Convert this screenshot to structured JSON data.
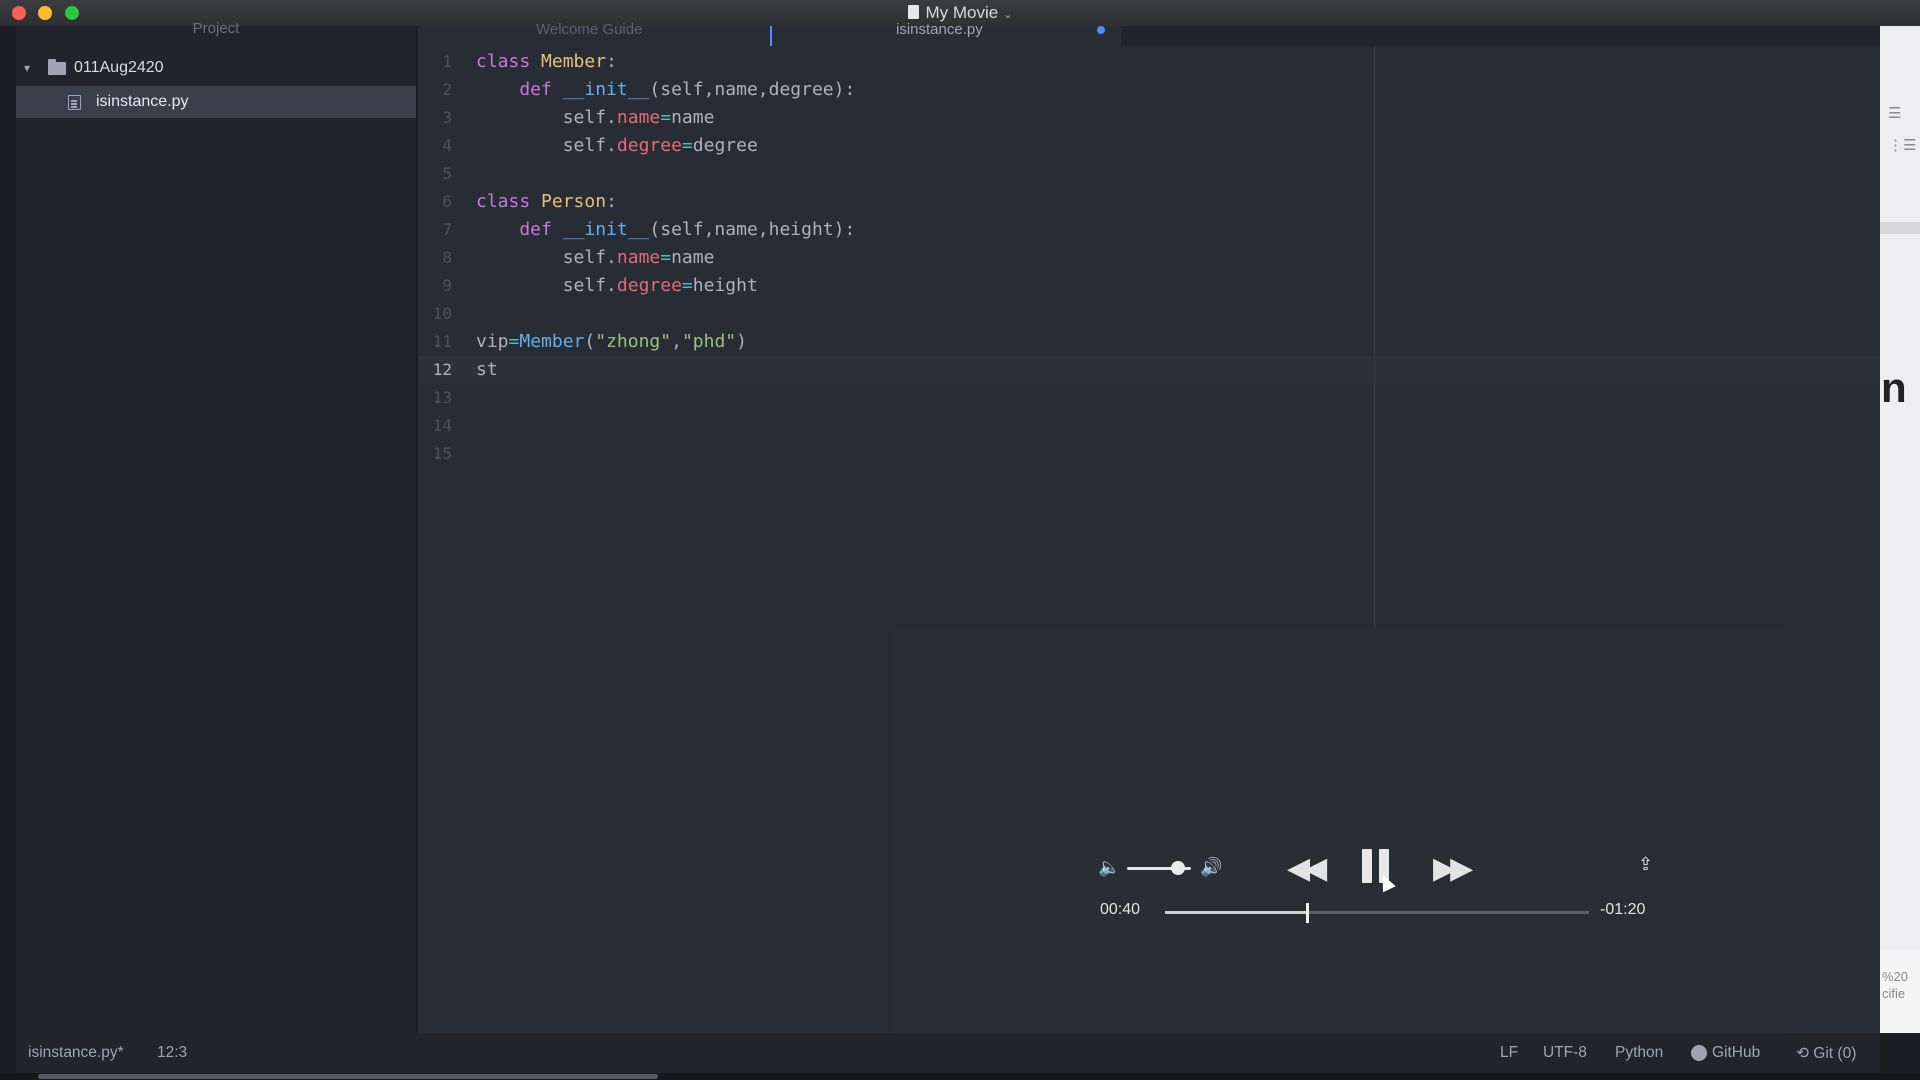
{
  "window": {
    "title": "My Movie",
    "title_chevron": "⌄"
  },
  "sidebar": {
    "panel_title": "Project",
    "root_folder": "011Aug2420",
    "root_arrow": "▾",
    "files": [
      {
        "label": "isinstance.py",
        "selected": true
      }
    ]
  },
  "tabs": [
    {
      "label": "Welcome Guide",
      "active": false
    },
    {
      "label": "isinstance.py",
      "active": true,
      "modified": true
    }
  ],
  "editor": {
    "current_line": 12,
    "line_numbers": [
      "1",
      "2",
      "3",
      "4",
      "5",
      "6",
      "7",
      "8",
      "9",
      "10",
      "11",
      "12",
      "13",
      "14",
      "15"
    ],
    "lines": [
      [
        {
          "t": "class ",
          "c": "kw"
        },
        {
          "t": "Member",
          "c": "cls"
        },
        {
          "t": ":",
          "c": "plain"
        }
      ],
      [
        {
          "t": "    def ",
          "c": "kw"
        },
        {
          "t": "__init__",
          "c": "fn"
        },
        {
          "t": "(self,name,degree):",
          "c": "plain"
        }
      ],
      [
        {
          "t": "        self.",
          "c": "plain"
        },
        {
          "t": "name",
          "c": "prop"
        },
        {
          "t": "=",
          "c": "op"
        },
        {
          "t": "name",
          "c": "plain"
        }
      ],
      [
        {
          "t": "        self.",
          "c": "plain"
        },
        {
          "t": "degree",
          "c": "prop"
        },
        {
          "t": "=",
          "c": "op"
        },
        {
          "t": "degree",
          "c": "plain"
        }
      ],
      [],
      [
        {
          "t": "class ",
          "c": "kw"
        },
        {
          "t": "Person",
          "c": "cls"
        },
        {
          "t": ":",
          "c": "plain"
        }
      ],
      [
        {
          "t": "    def ",
          "c": "kw"
        },
        {
          "t": "__init__",
          "c": "fn"
        },
        {
          "t": "(self,name,height):",
          "c": "plain"
        }
      ],
      [
        {
          "t": "        self.",
          "c": "plain"
        },
        {
          "t": "name",
          "c": "prop"
        },
        {
          "t": "=",
          "c": "op"
        },
        {
          "t": "name",
          "c": "plain"
        }
      ],
      [
        {
          "t": "        self.",
          "c": "plain"
        },
        {
          "t": "degree",
          "c": "prop"
        },
        {
          "t": "=",
          "c": "op"
        },
        {
          "t": "height",
          "c": "plain"
        }
      ],
      [],
      [
        {
          "t": "vip",
          "c": "plain"
        },
        {
          "t": "=",
          "c": "op"
        },
        {
          "t": "Member",
          "c": "fn"
        },
        {
          "t": "(",
          "c": "plain"
        },
        {
          "t": "\"zhong\"",
          "c": "str"
        },
        {
          "t": ",",
          "c": "plain"
        },
        {
          "t": "\"phd\"",
          "c": "str"
        },
        {
          "t": ")",
          "c": "plain"
        }
      ],
      [
        {
          "t": "st",
          "c": "plain"
        }
      ],
      [],
      [],
      []
    ]
  },
  "player": {
    "current_time": "00:40",
    "remaining_time": "-01:20",
    "progress": 0.333,
    "volume": 0.8,
    "vol_low_icon": "🔈",
    "vol_high_icon": "🔊",
    "rewind_icon": "◀◀",
    "forward_icon": "▶▶",
    "share_icon": "⇪"
  },
  "right_panel": {
    "partial_text": "n",
    "icon1": "☰",
    "icon2": "⋮☰",
    "small_text": "%20\ncifie"
  },
  "status_bar": {
    "file": "isinstance.py*",
    "cursor": "12:3",
    "line_ending": "LF",
    "encoding": "UTF-8",
    "language": "Python",
    "github": "GitHub",
    "git": "⟲ Git (0)"
  }
}
